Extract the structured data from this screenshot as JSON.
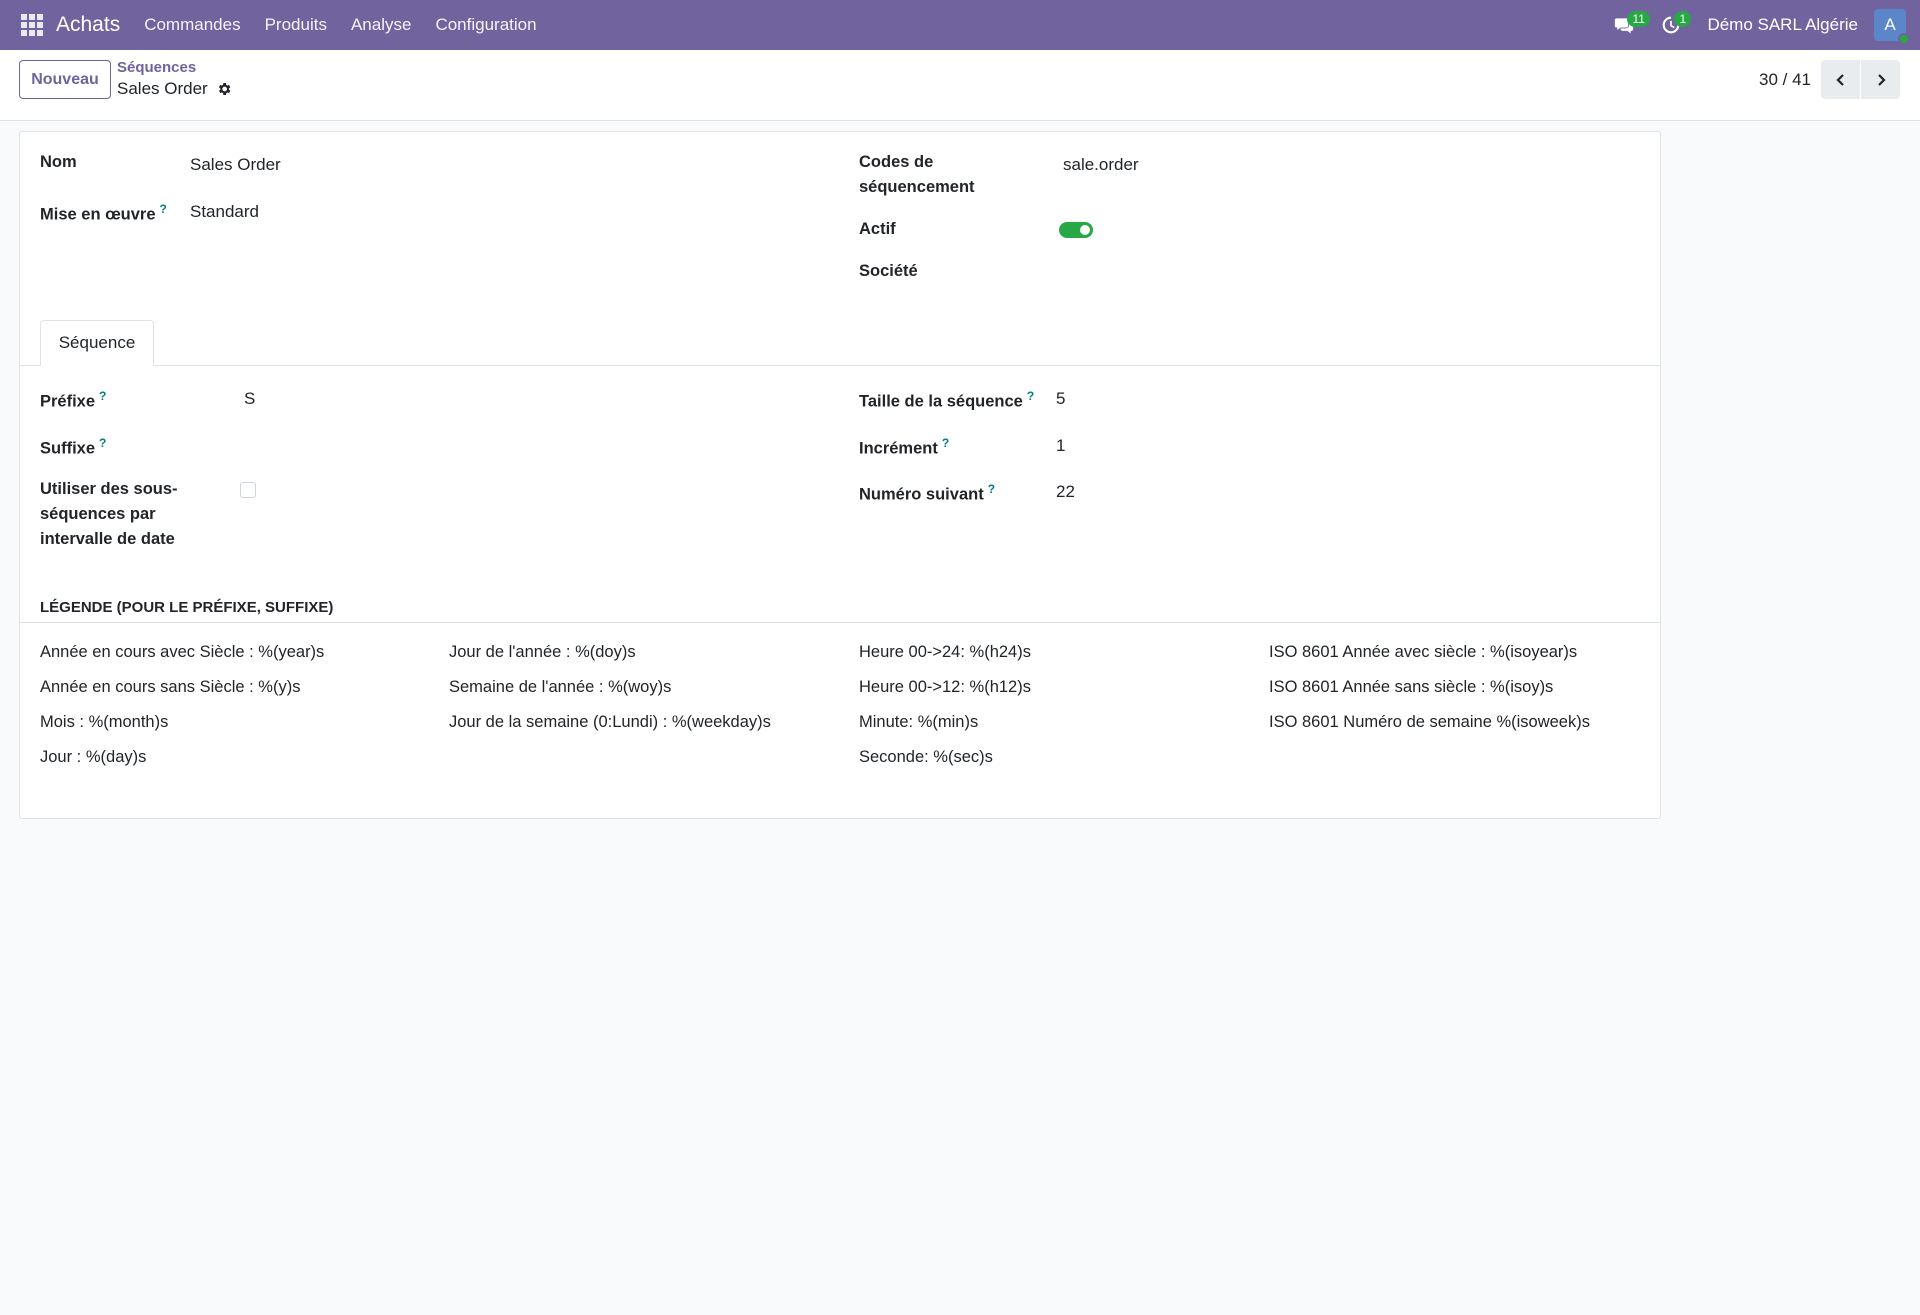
{
  "navbar": {
    "app_name": "Achats",
    "menu": [
      "Commandes",
      "Produits",
      "Analyse",
      "Configuration"
    ],
    "messages_count": "11",
    "activities_count": "1",
    "company": "Démo SARL Algérie",
    "avatar_initial": "A"
  },
  "control_panel": {
    "new_button": "Nouveau",
    "breadcrumb_parent": "Séquences",
    "record_title": "Sales Order",
    "pager": "30 / 41"
  },
  "form": {
    "name_label": "Nom",
    "name_value": "Sales Order",
    "implementation_label": "Mise en œuvre",
    "implementation_value": "Standard",
    "code_label": "Codes de séquencement",
    "code_value": "sale.order",
    "active_label": "Actif",
    "company_label": "Société",
    "help_mark": "?"
  },
  "tab": {
    "label": "Séquence"
  },
  "sequence": {
    "prefix_label": "Préfixe",
    "prefix_value": "S",
    "suffix_label": "Suffixe",
    "subseq_label": "Utiliser des sous-séquences par intervalle de date",
    "size_label": "Taille de la séquence",
    "size_value": "5",
    "increment_label": "Incrément",
    "increment_value": "1",
    "next_label": "Numéro suivant",
    "next_value": "22"
  },
  "legend": {
    "title": "LÉGENDE (POUR LE PRÉFIXE, SUFFIXE)",
    "col1": [
      "Année en cours avec Siècle : %(year)s",
      "Année en cours sans Siècle : %(y)s",
      "Mois : %(month)s",
      "Jour : %(day)s"
    ],
    "col2": [
      "Jour de l'année : %(doy)s",
      "Semaine de l'année : %(woy)s",
      "Jour de la semaine (0:Lundi) : %(weekday)s"
    ],
    "col3": [
      "Heure 00->24: %(h24)s",
      "Heure 00->12: %(h12)s",
      "Minute: %(min)s",
      "Seconde: %(sec)s"
    ],
    "col4": [
      "ISO 8601 Année avec siècle : %(isoyear)s",
      "ISO 8601 Année sans siècle : %(isoy)s",
      "ISO 8601 Numéro de semaine %(isoweek)s"
    ]
  },
  "colors": {
    "brand": "#71639e",
    "success": "#28a745",
    "help": "#017e84"
  }
}
